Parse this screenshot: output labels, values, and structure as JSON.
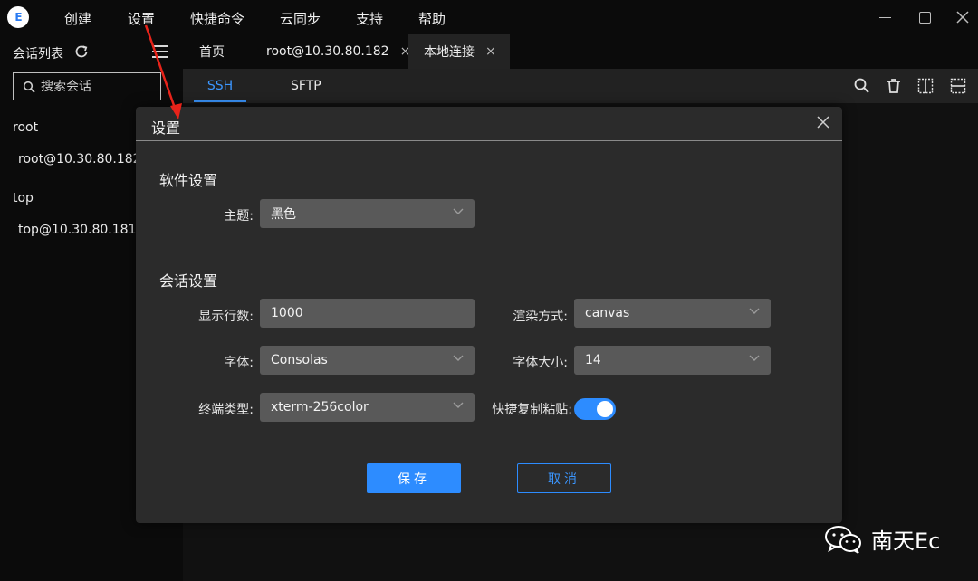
{
  "logo": {
    "text": "E"
  },
  "menu": [
    "创建",
    "设置",
    "快捷命令",
    "云同步",
    "支持",
    "帮助"
  ],
  "sidebar": {
    "title": "会话列表",
    "search_placeholder": "搜索会话",
    "groups": [
      {
        "name": "root",
        "items": [
          "root@10.30.80.182"
        ]
      },
      {
        "name": "top",
        "items": [
          "top@10.30.80.181"
        ]
      }
    ]
  },
  "tabs": [
    {
      "label": "首页",
      "closable": false
    },
    {
      "label": "root@10.30.80.182",
      "closable": true,
      "close": "×"
    },
    {
      "label": "本地连接",
      "closable": true,
      "close": "×"
    }
  ],
  "subtabs": [
    "SSH",
    "SFTP"
  ],
  "toolbar_icons": [
    "search-icon",
    "trash-icon",
    "split-vertical-icon",
    "split-horizontal-icon"
  ],
  "dialog": {
    "title": "设置",
    "software_section": "软件设置",
    "theme_label": "主题:",
    "theme_value": "黑色",
    "session_section": "会话设置",
    "rows_label": "显示行数:",
    "rows_value": "1000",
    "render_label": "渲染方式:",
    "render_value": "canvas",
    "font_label": "字体:",
    "font_value": "Consolas",
    "fontsize_label": "字体大小:",
    "fontsize_value": "14",
    "termtype_label": "终端类型:",
    "termtype_value": "xterm-256color",
    "copypaste_label": "快捷复制粘贴:",
    "copypaste_on": true,
    "save_label": "保存",
    "cancel_label": "取消"
  },
  "colors": {
    "accent": "#2d8cff",
    "annotation_arrow": "#e8231a",
    "field_bg": "#595959",
    "dialog_bg": "#2b2b2b"
  },
  "watermark": {
    "text": "南天Ec",
    "icon": "wechat-icon"
  }
}
